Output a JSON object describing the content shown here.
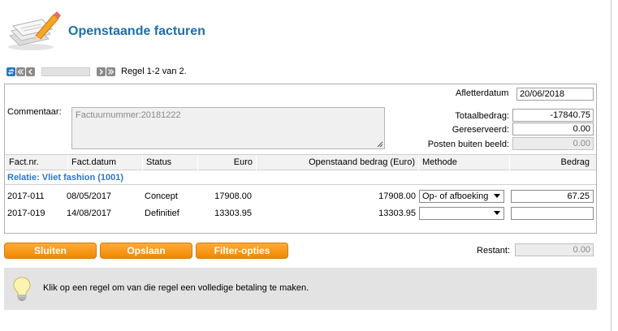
{
  "page": {
    "title": "Openstaande facturen"
  },
  "pager": {
    "status": "Regel 1-2 van 2."
  },
  "form": {
    "afletterdatum_label": "Afletterdatum",
    "afletterdatum_value": "20/06/2018",
    "commentaar_label": "Commentaar:",
    "commentaar_value": "Factuurnummer:20181222",
    "totaalbedrag_label": "Totaalbedrag:",
    "totaalbedrag_value": "-17840.75",
    "gereserveerd_label": "Gereserveerd:",
    "gereserveerd_value": "0.00",
    "posten_label": "Posten buiten beeld:",
    "posten_value": "0.00"
  },
  "table": {
    "headers": [
      "Fact.nr.",
      "Fact.datum",
      "Status",
      "Euro",
      "Openstaand bedrag (Euro)",
      "Methode",
      "Bedrag"
    ],
    "relation": "Relatie: Vliet fashion (1001)",
    "rows": [
      {
        "factnr": "2017-011",
        "datum": "08/05/2017",
        "status": "Concept",
        "euro": "17908.00",
        "openstaand": "17908.00",
        "methode": "Op- of afboeking",
        "bedrag": "67.25"
      },
      {
        "factnr": "2017-019",
        "datum": "14/08/2017",
        "status": "Definitief",
        "euro": "13303.95",
        "openstaand": "13303.95",
        "methode": "",
        "bedrag": ""
      }
    ]
  },
  "buttons": {
    "sluiten": "Sluiten",
    "opslaan": "Opslaan",
    "filter": "Filter-opties"
  },
  "restant": {
    "label": "Restant:",
    "value": "0.00"
  },
  "tip": {
    "text": "Klik op een regel om van die regel een volledige betaling te maken."
  },
  "colors": {
    "title": "#1d6fae",
    "accent_blue": "#2a78c8",
    "button_orange": "#f59300"
  }
}
